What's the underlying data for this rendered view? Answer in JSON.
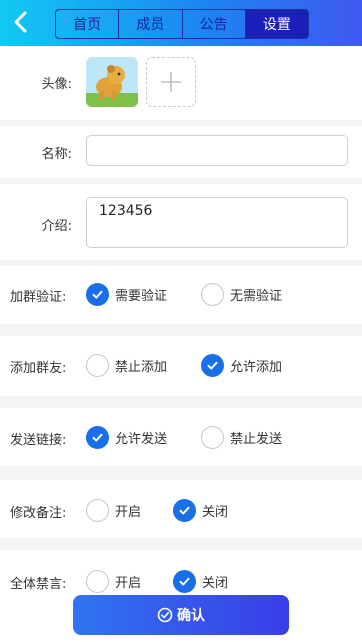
{
  "tabs": [
    "首页",
    "成员",
    "公告",
    "设置"
  ],
  "fields": {
    "avatar_label": "头像:",
    "name_label": "名称:",
    "name_value": "",
    "intro_label": "介绍:",
    "intro_value": "123456"
  },
  "settings": [
    {
      "label": "加群验证:",
      "options": [
        "需要验证",
        "无需验证"
      ],
      "selected": 0
    },
    {
      "label": "添加群友:",
      "options": [
        "禁止添加",
        "允许添加"
      ],
      "selected": 1
    },
    {
      "label": "发送链接:",
      "options": [
        "允许发送",
        "禁止发送"
      ],
      "selected": 0
    },
    {
      "label": "修改备注:",
      "options": [
        "开启",
        "关闭"
      ],
      "selected": 1
    },
    {
      "label": "全体禁言:",
      "options": [
        "开启",
        "关闭"
      ],
      "selected": 1
    }
  ],
  "confirm_label": "确认",
  "colors": {
    "accent": "#1a6fe8",
    "header_start": "#12c9f4",
    "header_end": "#3f59f0"
  }
}
